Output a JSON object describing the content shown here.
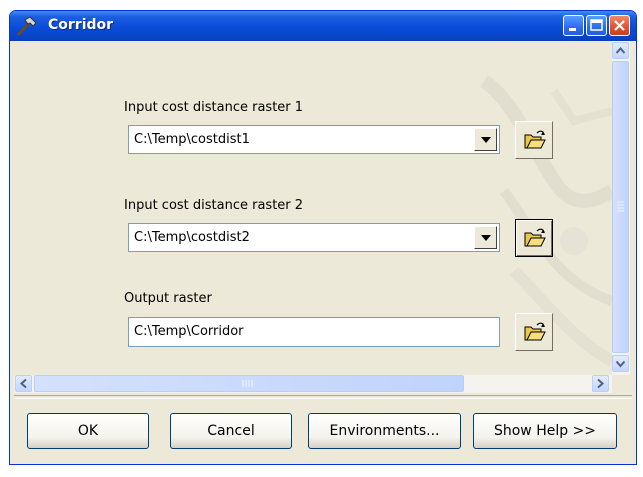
{
  "window": {
    "title": "Corridor",
    "title_icon": "hammer-icon"
  },
  "fields": {
    "raster1": {
      "label": "Input cost distance raster 1",
      "value": "C:\\Temp\\costdist1"
    },
    "raster2": {
      "label": "Input cost distance raster 2",
      "value": "C:\\Temp\\costdist2"
    },
    "output": {
      "label": "Output raster",
      "value": "C:\\Temp\\Corridor"
    }
  },
  "buttons": {
    "ok": "OK",
    "cancel": "Cancel",
    "environments": "Environments...",
    "show_help": "Show Help >>"
  },
  "colors": {
    "titlebar": "#0A4CD8",
    "dialog_bg": "#ECE9D8",
    "border": "#0831D9"
  }
}
